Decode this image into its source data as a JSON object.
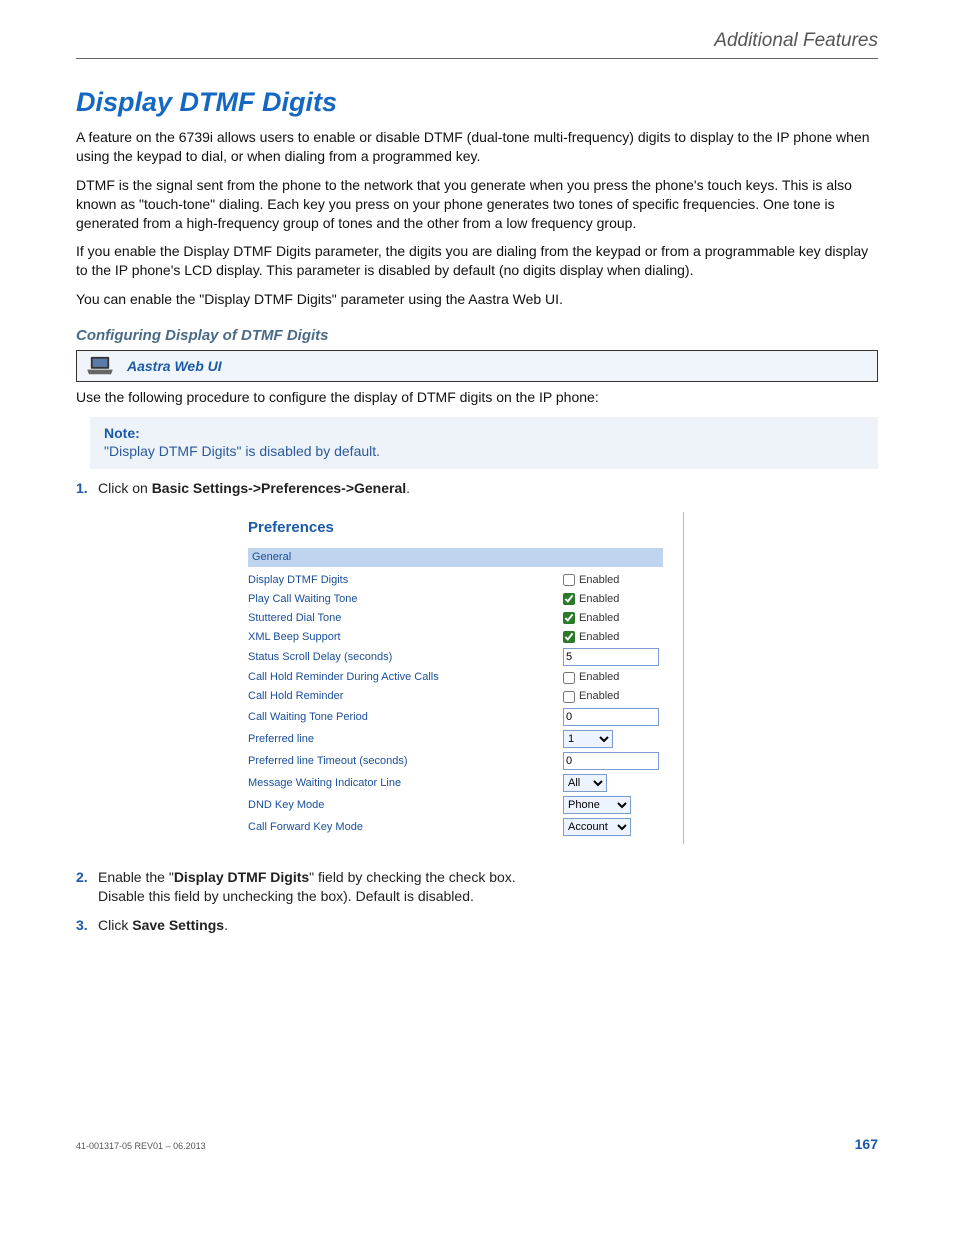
{
  "header": {
    "breadcrumb": "Additional Features"
  },
  "title": "Display DTMF Digits",
  "paras": {
    "p1": "A feature on the 6739i allows users to enable or disable DTMF (dual-tone multi-frequency) digits to display to the IP phone when using the keypad to dial, or when dialing from a programmed key.",
    "p2": "DTMF is the signal sent from the phone to the network that you generate when you press the phone's touch keys. This is also known as \"touch-tone\" dialing. Each key you press on your phone generates two tones of specific frequencies. One tone is generated from a high-frequency group of tones and the other from a low frequency group.",
    "p3": "If you enable the Display DTMF Digits parameter, the digits you are dialing from the keypad or from a programmable key display to the IP phone's LCD display. This parameter is disabled by default (no digits display when dialing).",
    "p4": "You can enable the \"Display DTMF Digits\" parameter using the Aastra Web UI."
  },
  "subhead": "Configuring Display of DTMF Digits",
  "webui_label": "Aastra Web UI",
  "intro_line": "Use the following procedure to configure the display of DTMF digits on the IP phone:",
  "note": {
    "title": "Note:",
    "body": "\"Display DTMF Digits\" is disabled by default."
  },
  "steps": {
    "s1_pre": "Click on ",
    "s1_bold": "Basic Settings->Preferences->General",
    "s1_post": ".",
    "s2_pre": "Enable the \"",
    "s2_bold": "Display DTMF Digits",
    "s2_mid": "\" field by checking the check box.",
    "s2_line2": "Disable this field by unchecking the box). Default is disabled.",
    "s3_pre": "Click ",
    "s3_bold": "Save Settings",
    "s3_post": "."
  },
  "preferences": {
    "heading": "Preferences",
    "group": "General",
    "enabled_label": "Enabled",
    "rows": {
      "r1": {
        "label": "Display DTMF Digits"
      },
      "r2": {
        "label": "Play Call Waiting Tone"
      },
      "r3": {
        "label": "Stuttered Dial Tone"
      },
      "r4": {
        "label": "XML Beep Support"
      },
      "r5": {
        "label": "Status Scroll Delay (seconds)",
        "value": "5"
      },
      "r6": {
        "label": "Call Hold Reminder During Active Calls"
      },
      "r7": {
        "label": "Call Hold Reminder"
      },
      "r8": {
        "label": "Call Waiting Tone Period",
        "value": "0"
      },
      "r9": {
        "label": "Preferred line",
        "value": "1"
      },
      "r10": {
        "label": "Preferred line Timeout (seconds)",
        "value": "0"
      },
      "r11": {
        "label": "Message Waiting Indicator Line",
        "value": "All"
      },
      "r12": {
        "label": "DND Key Mode",
        "value": "Phone"
      },
      "r13": {
        "label": "Call Forward Key Mode",
        "value": "Account"
      }
    }
  },
  "footer": {
    "doc_id": "41-001317-05 REV01 – 06.2013",
    "page": "167"
  }
}
